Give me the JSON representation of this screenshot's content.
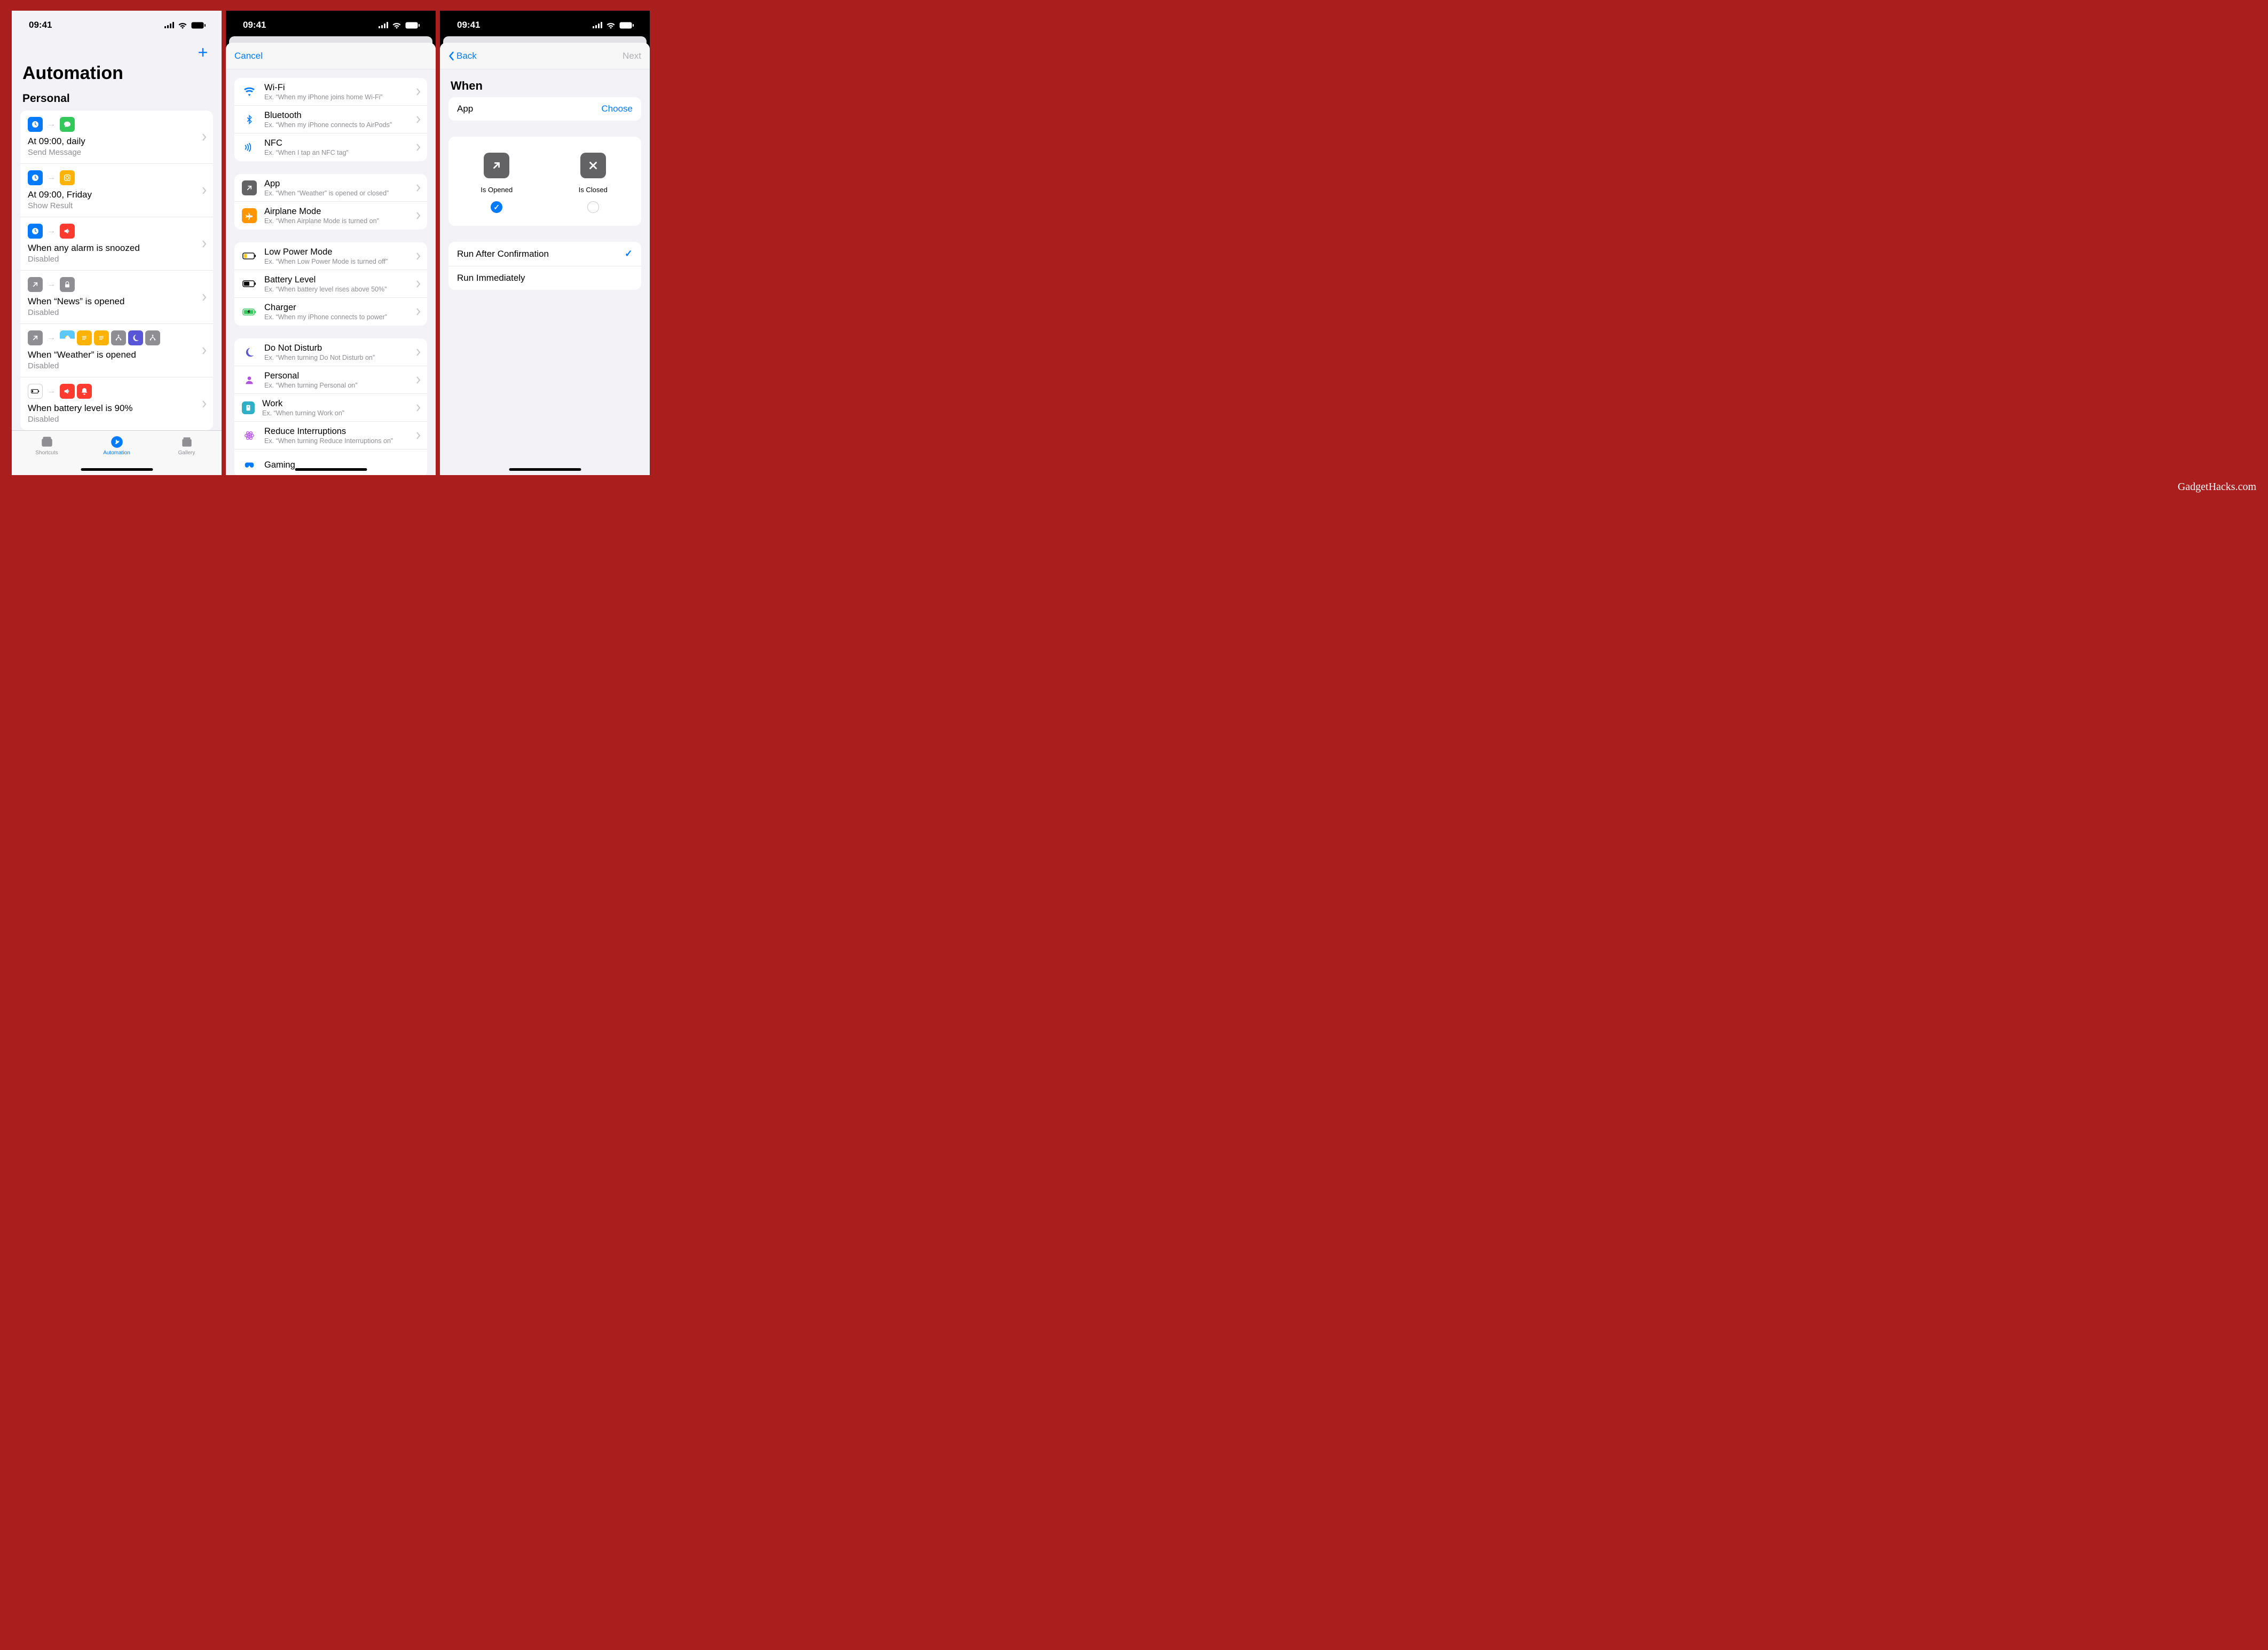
{
  "status": {
    "time": "09:41"
  },
  "watermark": "GadgetHacks.com",
  "phone1": {
    "title": "Automation",
    "subtitle": "Personal",
    "tabs": [
      {
        "label": "Shortcuts"
      },
      {
        "label": "Automation"
      },
      {
        "label": "Gallery"
      }
    ],
    "items": [
      {
        "title": "At 09:00, daily",
        "sub": "Send Message"
      },
      {
        "title": "At 09:00, Friday",
        "sub": "Show Result"
      },
      {
        "title": "When any alarm is snoozed",
        "sub": "Disabled"
      },
      {
        "title": "When “News” is opened",
        "sub": "Disabled"
      },
      {
        "title": "When “Weather” is opened",
        "sub": "Disabled"
      },
      {
        "title": "When battery level is 90%",
        "sub": "Disabled"
      }
    ]
  },
  "phone2": {
    "cancel": "Cancel",
    "groups": [
      [
        {
          "title": "Wi-Fi",
          "sub": "Ex. “When my iPhone joins home Wi-Fi”"
        },
        {
          "title": "Bluetooth",
          "sub": "Ex. “When my iPhone connects to AirPods”"
        },
        {
          "title": "NFC",
          "sub": "Ex. “When I tap an NFC tag”"
        }
      ],
      [
        {
          "title": "App",
          "sub": "Ex. “When “Weather” is opened or closed”"
        },
        {
          "title": "Airplane Mode",
          "sub": "Ex. “When Airplane Mode is turned on”"
        }
      ],
      [
        {
          "title": "Low Power Mode",
          "sub": "Ex. “When Low Power Mode is turned off”"
        },
        {
          "title": "Battery Level",
          "sub": "Ex. “When battery level rises above 50%”"
        },
        {
          "title": "Charger",
          "sub": "Ex. “When my iPhone connects to power”"
        }
      ],
      [
        {
          "title": "Do Not Disturb",
          "sub": "Ex. “When turning Do Not Disturb on”"
        },
        {
          "title": "Personal",
          "sub": "Ex. “When turning Personal on”"
        },
        {
          "title": "Work",
          "sub": "Ex. “When turning Work on”"
        },
        {
          "title": "Reduce Interruptions",
          "sub": "Ex. “When turning Reduce Interruptions on”"
        },
        {
          "title": "Gaming",
          "sub": ""
        }
      ]
    ]
  },
  "phone3": {
    "back": "Back",
    "next": "Next",
    "when": "When",
    "chooser_label": "App",
    "chooser_action": "Choose",
    "tile_open": "Is Opened",
    "tile_close": "Is Closed",
    "run_confirm": "Run After Confirmation",
    "run_immediate": "Run Immediately"
  }
}
